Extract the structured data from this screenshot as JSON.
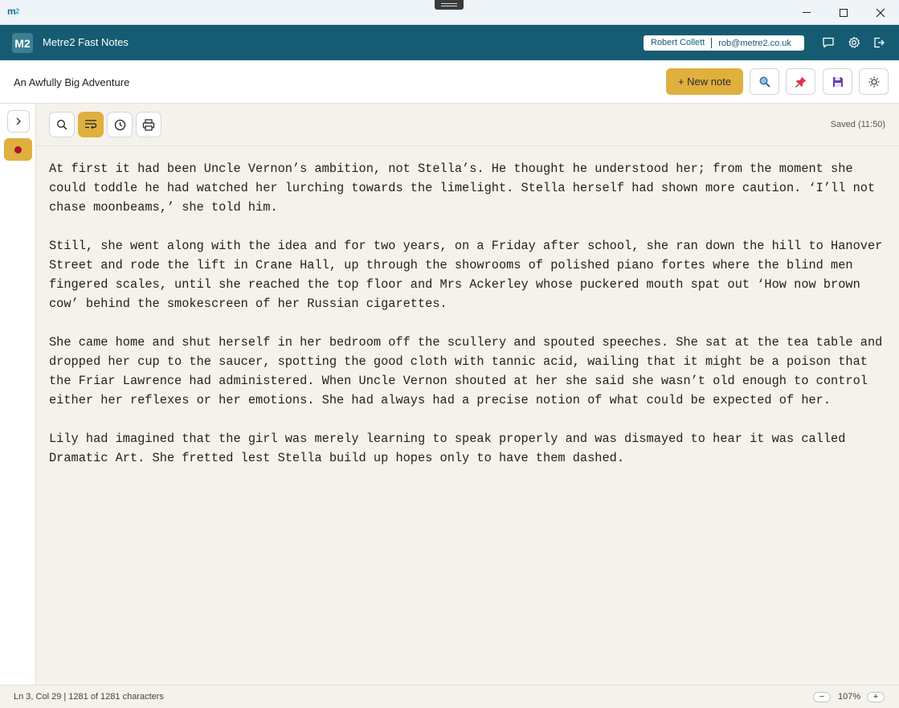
{
  "window": {
    "logo_main": "m",
    "logo_sub": "2"
  },
  "app": {
    "badge": "M2",
    "title": "Metre2 Fast Notes"
  },
  "user": {
    "name": "Robert Collett",
    "email": "rob@metre2.co.uk"
  },
  "header_icons": [
    "chat-icon",
    "gear-icon",
    "logout-icon"
  ],
  "document": {
    "title": "An Awfully Big Adventure",
    "new_note_label": "+ New note",
    "saved_status": "Saved (11:50)"
  },
  "editor": {
    "paragraphs": [
      "At first it had been Uncle Vernon’s ambition, not Stella’s. He thought he understood her; from the moment she could toddle he had watched her lurching towards the limelight. Stella herself had shown more caution. ‘I’ll not chase moonbeams,’ she told him.",
      "Still, she went along with the idea and for two years, on a Friday after school, she ran down the hill to Hanover Street and rode the lift in Crane Hall, up through the showrooms of polished piano fortes where the blind men fingered scales, until she reached the top floor and Mrs Ackerley whose puckered mouth spat out ‘How now brown cow’ behind the smokescreen of her Russian cigarettes.",
      "She came home and shut herself in her bedroom off the scullery and spouted speeches. She sat at the tea table and dropped her cup to the saucer, spotting the good cloth with tannic acid, wailing that it might be a poison that the Friar Lawrence had administered. When Uncle Vernon shouted at her she said she wasn’t old enough to control either her reflexes or her emotions. She had always had a precise notion of what could be expected of her.",
      "Lily had imagined that the girl was merely learning to speak properly and was dismayed to hear it was called Dramatic Art. She fretted lest Stella build up hopes only to have them dashed."
    ]
  },
  "status": {
    "position": "Ln 3, Col 29 | 1281 of 1281 characters",
    "zoom_out": "−",
    "zoom_level": "107%",
    "zoom_in": "+"
  },
  "colors": {
    "header": "#155c73",
    "accent": "#e0b03e",
    "editor_bg": "#f5f2eb",
    "record": "#b01030"
  }
}
